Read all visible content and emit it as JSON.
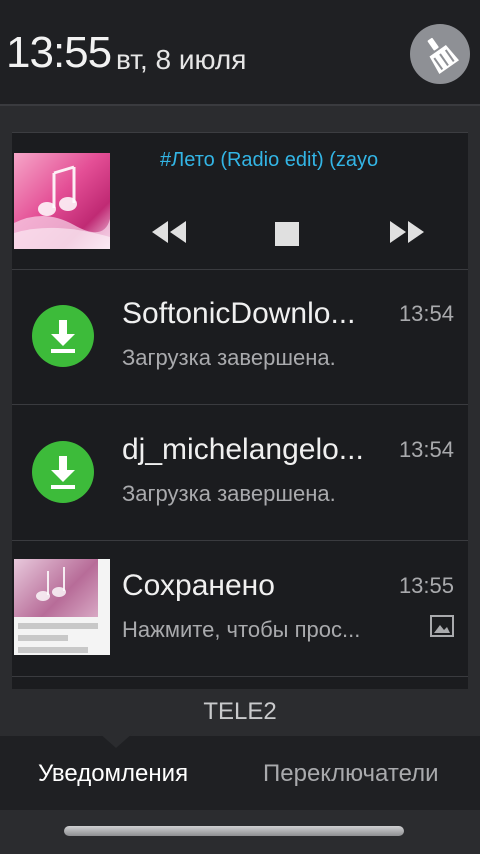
{
  "header": {
    "time": "13:55",
    "date": "вт, 8 июля",
    "clear_icon": "broom-icon"
  },
  "music": {
    "track": "#Лето (Radio edit) (zayo",
    "controls": [
      "previous-icon",
      "stop-icon",
      "next-icon"
    ]
  },
  "notifications": [
    {
      "title": "SoftonicDownlo...",
      "subtitle": "Загрузка завершена.",
      "time": "13:54",
      "icon": "download-icon"
    },
    {
      "title": "dj_michelangelo...",
      "subtitle": "Загрузка завершена.",
      "time": "13:54",
      "icon": "download-icon"
    },
    {
      "title": "Сохранено",
      "subtitle": "Нажмите, чтобы прос...",
      "time": "13:55",
      "icon": "image-icon"
    }
  ],
  "carrier": "TELE2",
  "tabs": [
    {
      "label": "Уведомления",
      "selected": true
    },
    {
      "label": "Переключатели",
      "selected": false
    }
  ],
  "colors": {
    "accent": "#33b5e5",
    "download_green": "#3dbb3a"
  }
}
